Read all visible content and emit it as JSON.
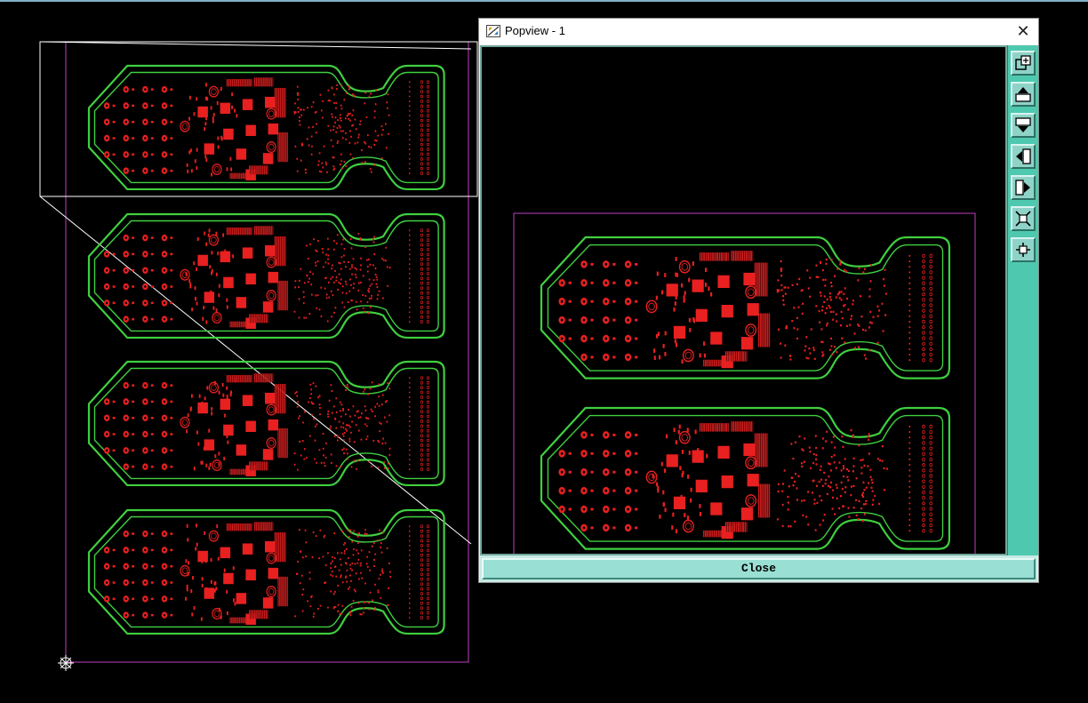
{
  "popview": {
    "title": "Popview - 1",
    "close_glyph": "✕",
    "close_button_label": "Close",
    "toolbar": [
      {
        "name": "zoom-window-icon"
      },
      {
        "name": "pan-up-icon"
      },
      {
        "name": "pan-down-icon"
      },
      {
        "name": "pan-left-icon"
      },
      {
        "name": "pan-right-icon"
      },
      {
        "name": "zoom-out-icon"
      },
      {
        "name": "zoom-in-icon"
      }
    ]
  },
  "board": {
    "panel_count": 4,
    "popview_panel_count": 2,
    "colors": {
      "outline": "#3fcf3f",
      "copper": "#e82020",
      "frame": "#c040c0",
      "window": "#ffffff",
      "toolbar": "#4ec9b0"
    }
  }
}
